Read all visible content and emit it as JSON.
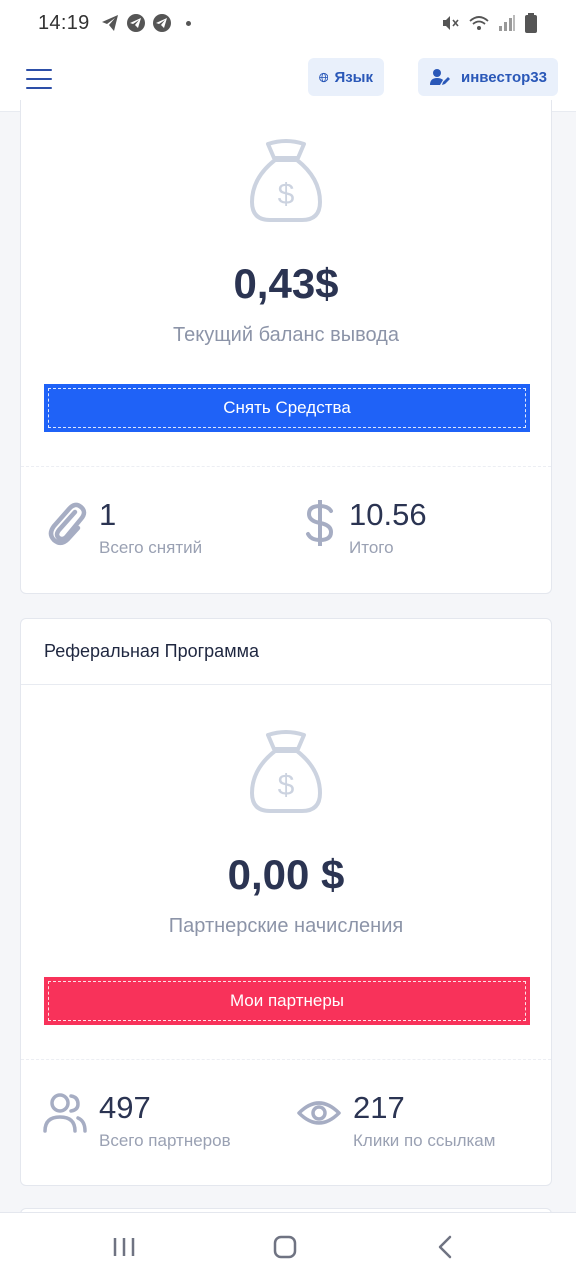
{
  "status_bar": {
    "time": "14:19",
    "left_icons": [
      "telegram-icon",
      "telegram-icon",
      "telegram-icon"
    ],
    "right_icons": [
      "mute-icon",
      "wifi-icon",
      "signal-icon",
      "battery-icon"
    ]
  },
  "header": {
    "language_label": "Язык",
    "user_label": "инвестор33"
  },
  "withdraw_card": {
    "amount": "0,43$",
    "subtitle": "Текущий баланс вывода",
    "button_label": "Снять Средства",
    "stats": [
      {
        "value": "1",
        "label": "Всего снятий",
        "icon": "paperclip-icon"
      },
      {
        "value": "10.56",
        "label": "Итого",
        "icon": "dollar-icon"
      }
    ]
  },
  "referral_card": {
    "title": "Реферальная Программа",
    "amount": "0,00 $",
    "subtitle": "Партнерские начисления",
    "button_label": "Мои партнеры",
    "stats": [
      {
        "value": "497",
        "label": "Всего партнеров",
        "icon": "users-icon"
      },
      {
        "value": "217",
        "label": "Клики по ссылкам",
        "icon": "eye-icon"
      }
    ]
  },
  "colors": {
    "primary_blue": "#1f62f7",
    "accent_red": "#f8325a",
    "text_dark": "#2b3452",
    "text_muted": "#8c94a8"
  },
  "navbar": {
    "items": [
      "recent-apps-icon",
      "home-icon",
      "back-icon"
    ]
  }
}
